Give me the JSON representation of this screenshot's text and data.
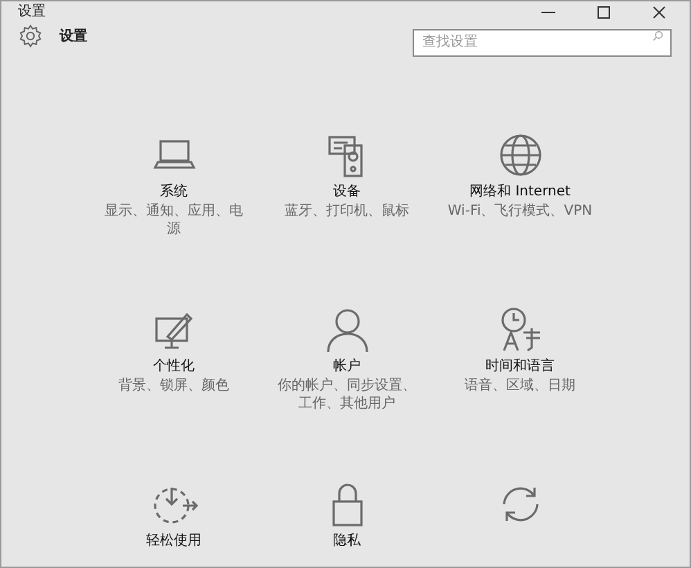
{
  "window": {
    "title": "设置"
  },
  "header": {
    "title": "设置",
    "search": {
      "placeholder": "查找设置"
    }
  },
  "tiles": [
    {
      "title": "系统",
      "subtitle": "显示、通知、应用、电源"
    },
    {
      "title": "设备",
      "subtitle": "蓝牙、打印机、鼠标"
    },
    {
      "title": "网络和 Internet",
      "subtitle": "Wi-Fi、飞行模式、VPN"
    },
    {
      "title": "个性化",
      "subtitle": "背景、锁屏、颜色"
    },
    {
      "title": "帐户",
      "subtitle": "你的帐户、同步设置、工作、其他用户"
    },
    {
      "title": "时间和语言",
      "subtitle": "语音、区域、日期"
    },
    {
      "title": "轻松使用"
    },
    {
      "title": "隐私"
    }
  ]
}
